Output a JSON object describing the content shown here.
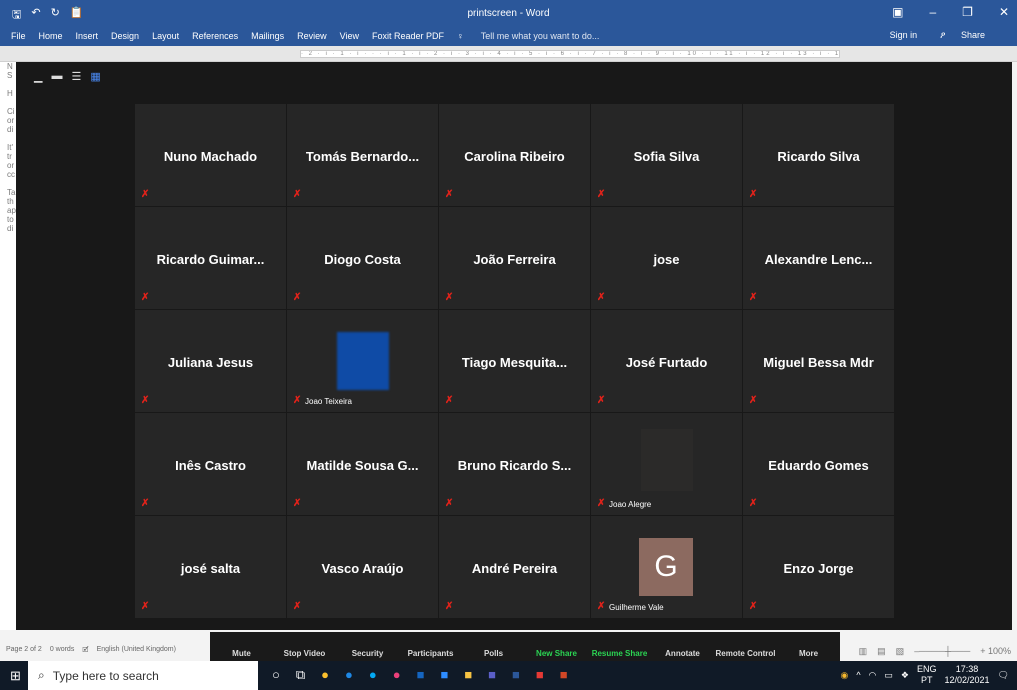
{
  "word": {
    "quick_access": [
      "🖫",
      "↶",
      "↻",
      "📋"
    ],
    "doc_title": "printscreen - Word",
    "ribbon_tabs": [
      "File",
      "Home",
      "Insert",
      "Design",
      "Layout",
      "References",
      "Mailings",
      "Review",
      "View",
      "Foxit Reader PDF"
    ],
    "tell_me": "Tell me what you want to do...",
    "sign_in": "Sign in",
    "share": "Share",
    "ruler_text": "· 2 · ı · 1 · ı · · · ı · 1 · ı · 2 · ı · 3 · ı · 4 · ı · 5 · ı · 6 · ı · 7 · ı · 8 · ı · 9 · ı · 10 · ı · 11 · ı · 12 · ı · 13 · ı · 14 · ı · 15 · ı · 17 · ı · 18",
    "left_margin_text": "N\nS\n\nH\n\nCi\nor\ndi\n\nIt'\ntr\nor\ncc\n\nTa\nth\nap\nto\ndi"
  },
  "zoom": {
    "participants": [
      {
        "name": "Nuno Machado"
      },
      {
        "name": "Tomás Bernardo..."
      },
      {
        "name": "Carolina Ribeiro"
      },
      {
        "name": "Sofia Silva"
      },
      {
        "name": "Ricardo Silva"
      },
      {
        "name": "Ricardo Guimar..."
      },
      {
        "name": "Diogo Costa"
      },
      {
        "name": "João Ferreira"
      },
      {
        "name": "jose"
      },
      {
        "name": "Alexandre Lenc..."
      },
      {
        "name": "Juliana Jesus"
      },
      {
        "name": "",
        "label": "Joao Teixeira",
        "video": "blue"
      },
      {
        "name": "Tiago Mesquita..."
      },
      {
        "name": "José Furtado"
      },
      {
        "name": "Miguel Bessa Mdr"
      },
      {
        "name": "Inês Castro"
      },
      {
        "name": "Matilde Sousa G..."
      },
      {
        "name": "Bruno Ricardo S..."
      },
      {
        "name": "",
        "label": "Joao Alegre",
        "video": "dark"
      },
      {
        "name": "Eduardo Gomes"
      },
      {
        "name": "josé salta"
      },
      {
        "name": "Vasco Araújo"
      },
      {
        "name": "André Pereira"
      },
      {
        "name": "",
        "label": "Guilherme Vale",
        "avatar": "G"
      },
      {
        "name": "Enzo Jorge"
      }
    ],
    "controls": [
      "Mute",
      "Stop Video",
      "Security",
      "Participants",
      "Polls",
      "New Share",
      "Resume Share",
      "Annotate",
      "Remote Control",
      "More"
    ],
    "green_controls": [
      "New Share",
      "Resume Share"
    ]
  },
  "status": {
    "page": "Page 2 of 2",
    "words": "0 words",
    "language": "English (United Kingdom)",
    "zoom_pct": "+ 100%"
  },
  "taskbar": {
    "search_placeholder": "Type here to search",
    "lang_top": "ENG",
    "lang_bottom": "PT",
    "time": "17:38",
    "date": "12/02/2021"
  }
}
